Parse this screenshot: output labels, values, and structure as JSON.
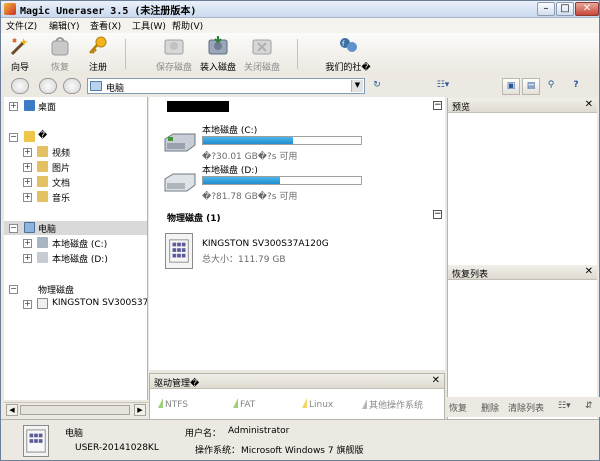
{
  "window": {
    "title": "Magic Uneraser 3.5 (未注册版本)"
  },
  "menu": [
    "文件(Z)",
    "编辑(Y)",
    "查看(X)",
    "工具(W)",
    "帮助(V)"
  ],
  "toolbar": {
    "wizard": "向导",
    "recover": "恢复",
    "register": "注册",
    "save_disk": "保存磁盘",
    "load_disk": "装入磁盘",
    "close_disk": "关闭磁盘",
    "community": "我们的社�"
  },
  "address": {
    "value": "电脑"
  },
  "tree": {
    "desktop": "桌面",
    "user_root": "�",
    "videos": "视频",
    "pictures": "图片",
    "documents": "文档",
    "music": "音乐",
    "computer": "电脑",
    "drive_c": "本地磁盘 (C:)",
    "drive_d": "本地磁盘 (D:)",
    "physical": "物理磁盘",
    "kingston": "KINGSTON SV300S37A12"
  },
  "drives": [
    {
      "name": "本地磁盘 (C:)",
      "free": "�?30.01 GB�?s 可用",
      "used_fraction": 0.57
    },
    {
      "name": "本地磁盘 (D:)",
      "free": "�?81.78 GB�?s 可用",
      "used_fraction": 0.49
    }
  ],
  "physical_section": {
    "title": "物理磁盘 (1)",
    "disk_name": "KINGSTON SV300S37A120G",
    "disk_size": "总大小：111.79 GB"
  },
  "drive_panel": {
    "title": "驱动管理�",
    "tabs": [
      "NTFS",
      "FAT",
      "Linux",
      "其他操作系统"
    ]
  },
  "preview": {
    "title": "预览"
  },
  "recovery_list": {
    "title": "恢复列表",
    "actions": [
      "恢复",
      "删除",
      "清除列表"
    ]
  },
  "status": {
    "label": "电脑",
    "host": "USER-20141028KL",
    "user_label": "用户名：",
    "user": "Administrator",
    "os_label": "操作系统：",
    "os": "Microsoft Windows 7 旗舰版"
  },
  "colors": {
    "bar_fill": "#2397d8",
    "accent": "#3a6ea5"
  }
}
